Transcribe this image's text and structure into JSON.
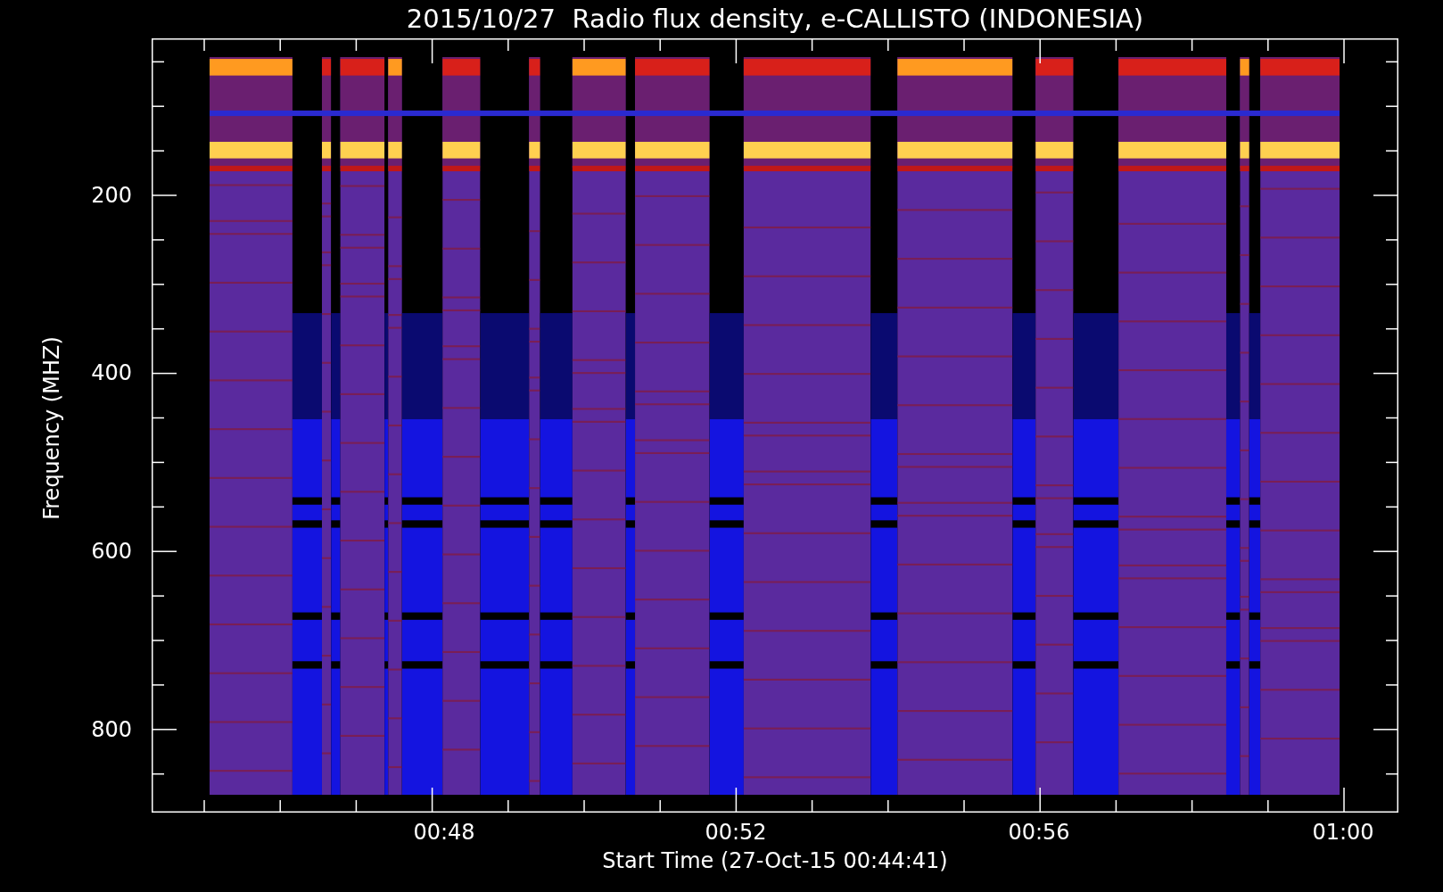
{
  "title": "2015/10/27  Radio flux density, e-CALLISTO (INDONESIA)",
  "ylabel": "Frequency (MHZ)",
  "yticks": [
    "200",
    "400",
    "600",
    "800"
  ],
  "xticks": [
    "00:48",
    "00:52",
    "00:56",
    "01:00"
  ],
  "xlabel": "Start Time (27-Oct-15 00:44:41)"
}
